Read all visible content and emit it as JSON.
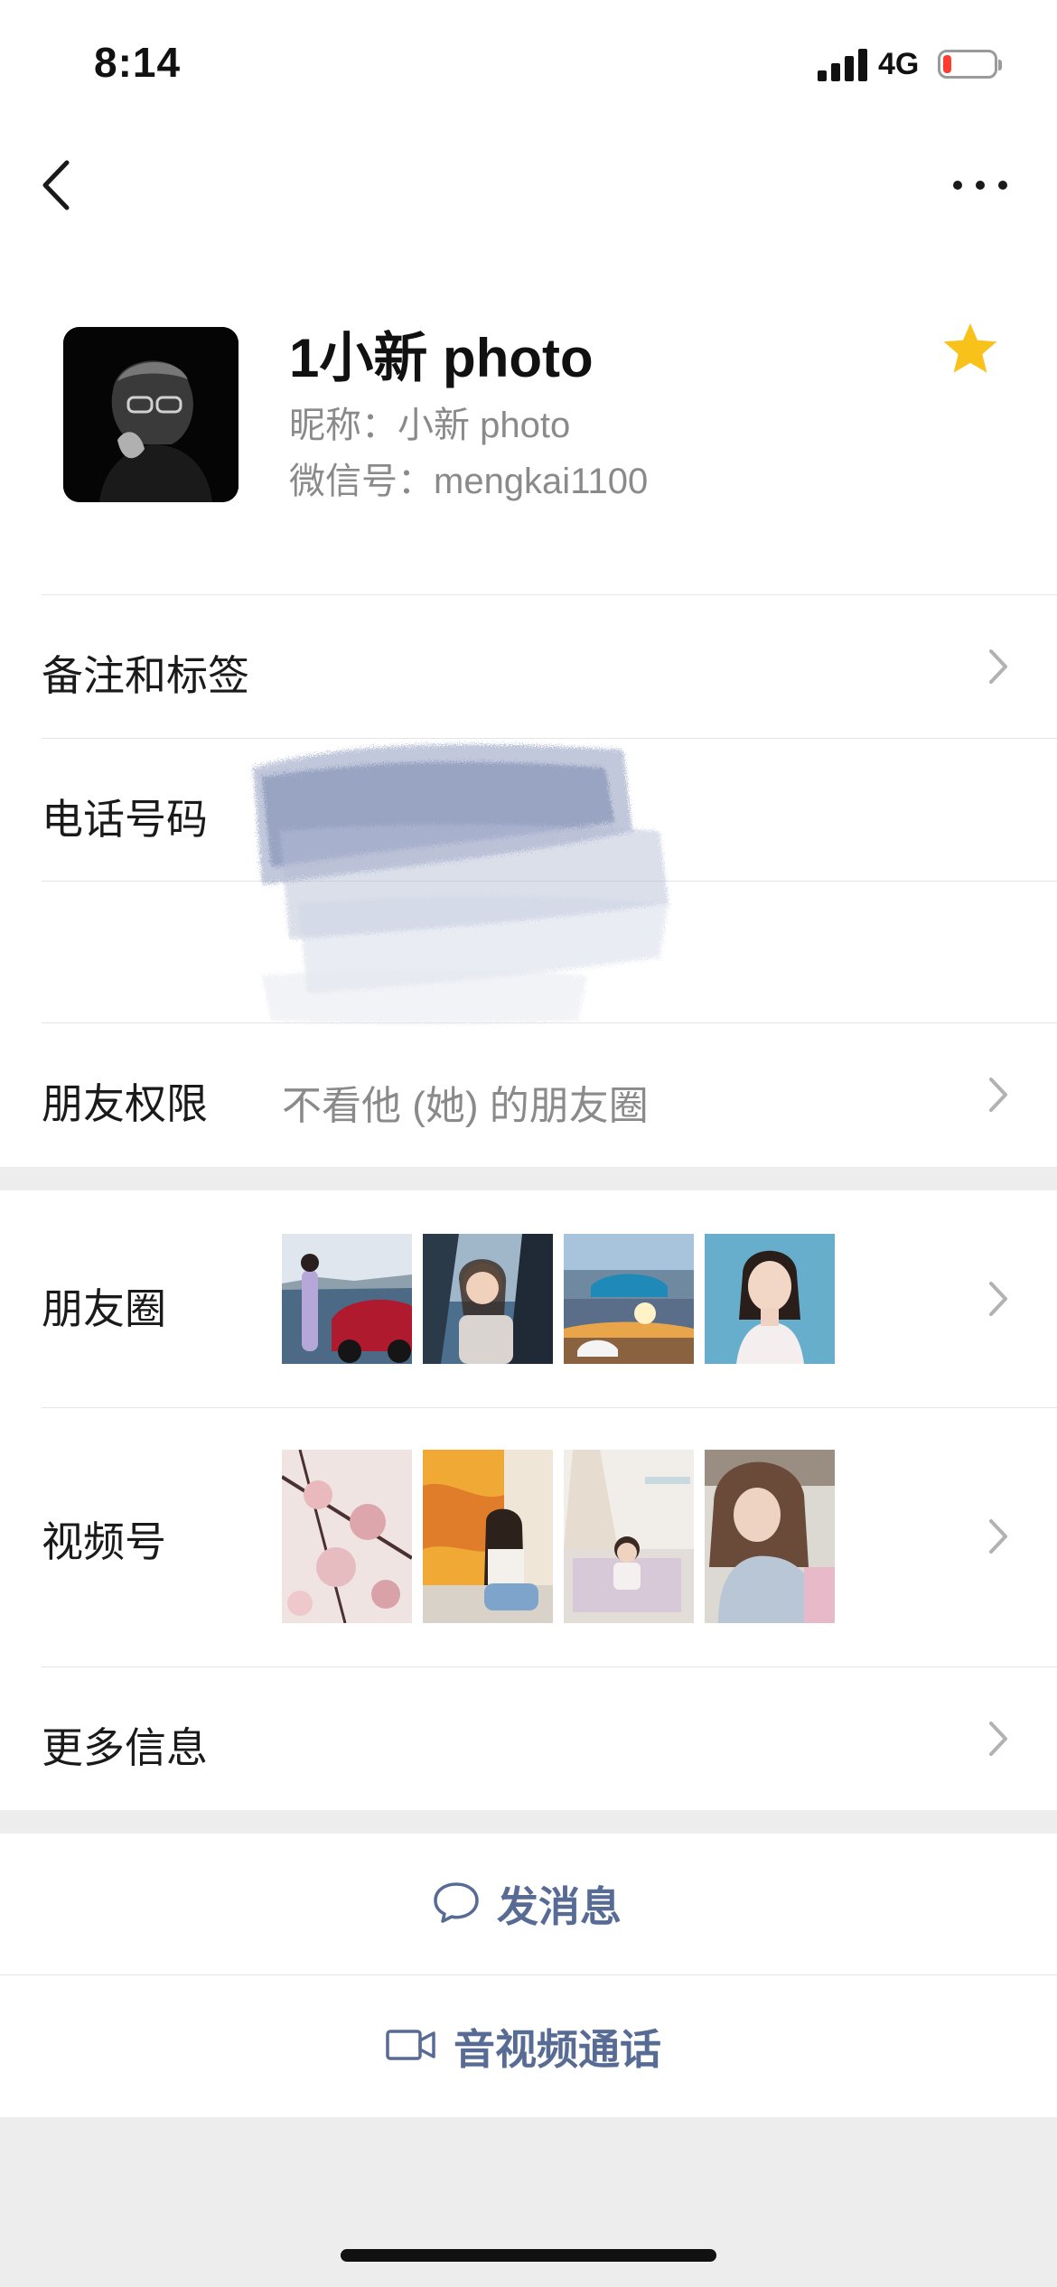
{
  "status_bar": {
    "time": "8:14",
    "network": "4G",
    "battery_level": 0.15,
    "battery_color": "#ff3b30"
  },
  "nav": {
    "back_icon": "chevron-left-icon",
    "more_icon": "ellipsis-icon"
  },
  "profile": {
    "display_name": "1小新 photo",
    "nickname": "昵称：小新 photo",
    "wechat_id": "微信号：mengkai1100",
    "starred": true,
    "star_color": "#f8c21b"
  },
  "rows": {
    "remarks_label": "备注和标签",
    "phone_label": "电话号码",
    "permissions_label": "朋友权限",
    "permissions_value": "不看他 (她) 的朋友圈",
    "moments_label": "朋友圈",
    "channels_label": "视频号",
    "more_info_label": "更多信息"
  },
  "actions": {
    "message_label": "发消息",
    "call_label": "音视频通话",
    "accent_color": "#576b95"
  }
}
